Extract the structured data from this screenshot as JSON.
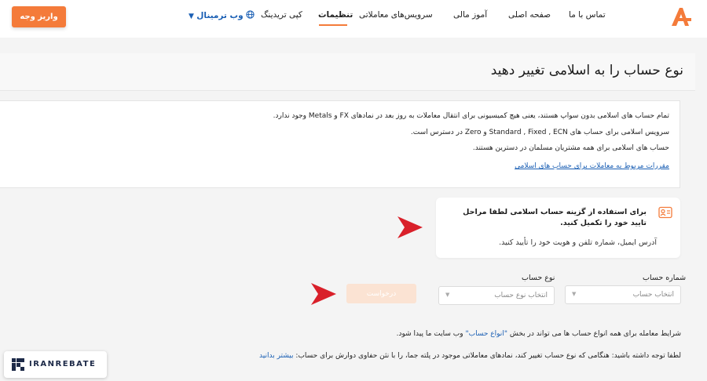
{
  "header": {
    "deposit_label": "واریز وجه",
    "web_terminal_label": "وب ترمینال",
    "nav": {
      "copy_trading": "کپی تریدینگ",
      "settings": "تنظیمات",
      "trading_services": "سرویس‌های معاملاتی",
      "financial_education": "آموز مالی",
      "home": "صفحه اصلی",
      "contact": "تماس با ما"
    }
  },
  "page": {
    "title": "نوع حساب را به اسلامی تغییر دهید"
  },
  "info": {
    "line1": "تمام حساب های اسلامی بدون سواپ هستند، یعنی هیچ کمیسیونی برای انتقال معاملات به روز بعد در نمادهای FX و Metals وجود ندارد.",
    "line2": "سرویس اسلامی برای حساب های Standard , Fixed , ECN و Zero در دسترس است.",
    "line3": "حساب های اسلامی برای همه مشتریان مسلمان در دسترین هستند.",
    "rules_link": "مقررات مربوط به معاملات برای حساب های اسلامی"
  },
  "verify": {
    "title": "برای استفاده از گزینه حساب اسلامی لطفا مراحل تایید خود را تکمیل کنید.",
    "subtitle": "آدرس ایمیل، شماره تلفن و هویت خود را تأیید کنید."
  },
  "form": {
    "account_number_label": "شماره حساب",
    "account_number_placeholder": "انتخاب حساب",
    "account_type_label": "نوع حساب",
    "account_type_placeholder": "انتخاب نوع حساب",
    "request_label": "درخواست"
  },
  "footer": {
    "line1_prefix": "شرایط معامله برای همه انواع حساب ها می تواند در بخش",
    "line1_link": "\"انواع حساب\"",
    "line1_suffix": "وب سایت ما پیدا شود.",
    "line2_text": "لطفا توجه داشته باشید: هنگامی که نوع حساب تغییر کند، نمادهای معاملاتی موجود در پلته جما، را با نثن حفاوی دوارش برای حساب:",
    "line2_link": "بیشتر بدانید"
  },
  "badge": {
    "text": "IRANREBATE"
  },
  "colors": {
    "accent": "#f47b3a",
    "link": "#1a5fb4",
    "arrow": "#d9202a",
    "brand_navy": "#1d2a48"
  },
  "icons": {
    "logo": "brand-a-logo",
    "globe": "globe-icon",
    "chevron": "chevron-down-icon",
    "verify": "id-card-icon",
    "arrow": "pointer-arrow-icon",
    "badge": "iranrebate-logo-icon"
  }
}
